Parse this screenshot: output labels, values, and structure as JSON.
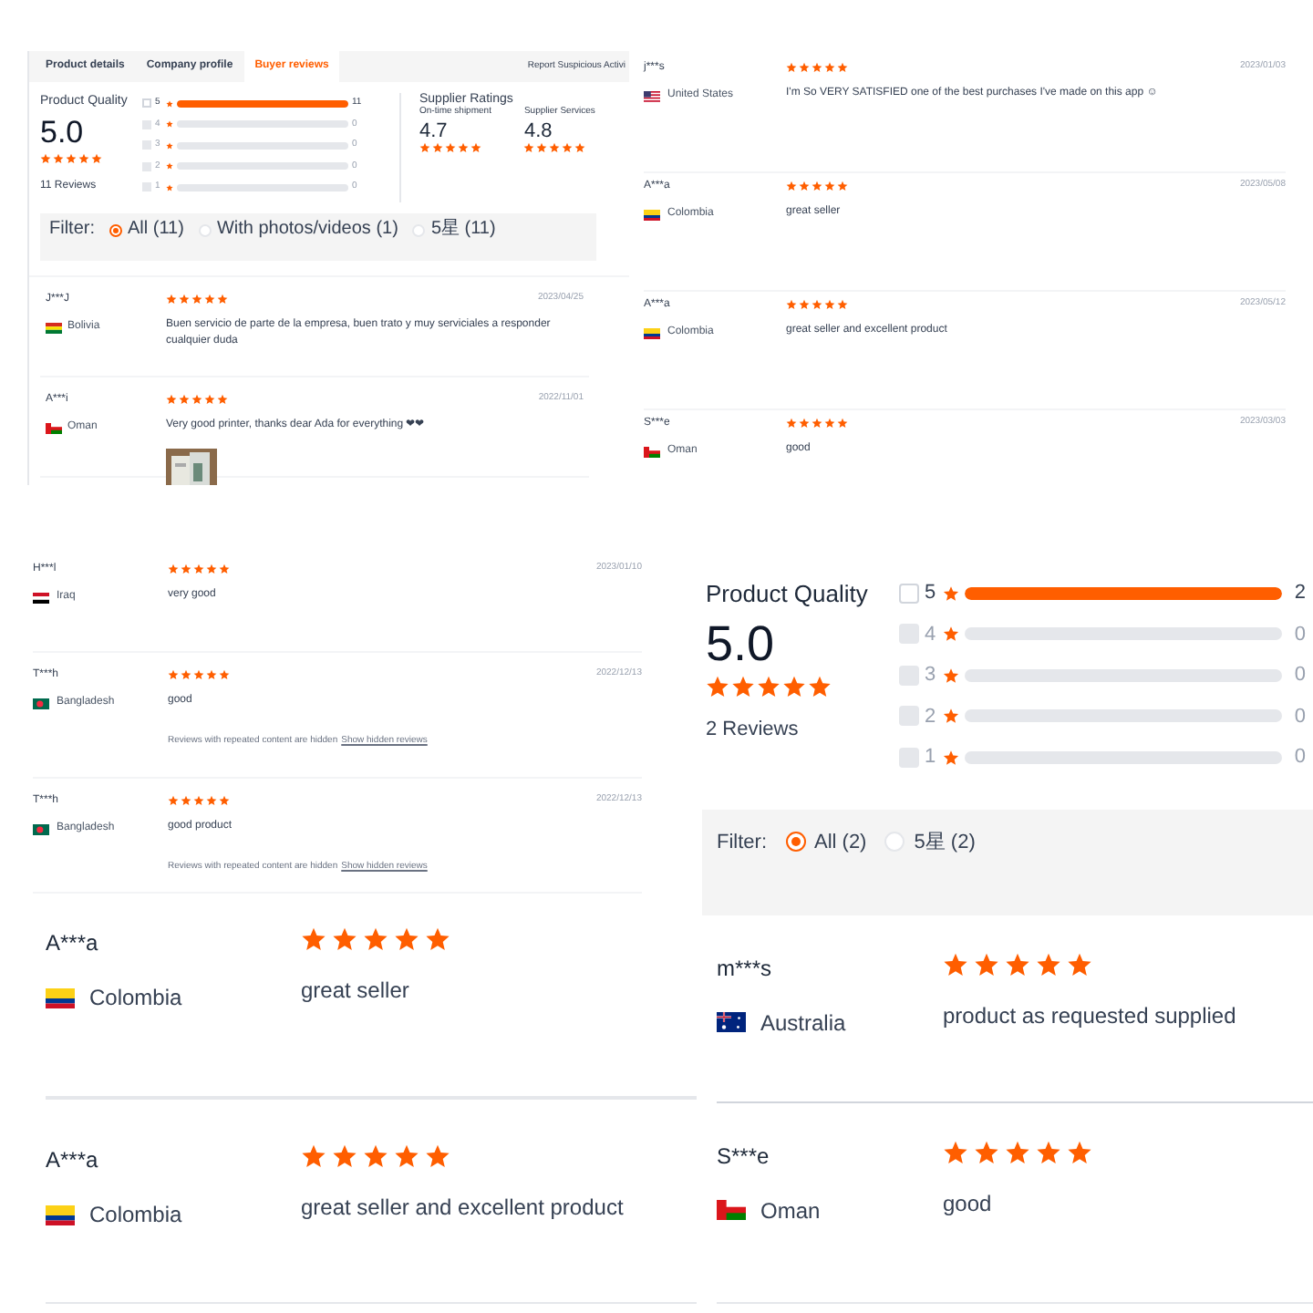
{
  "panel_1": {
    "tabs": [
      {
        "label": "Product details",
        "selected": false
      },
      {
        "label": "Company profile",
        "selected": false
      },
      {
        "label": "Buyer reviews",
        "selected": true
      }
    ],
    "report_link": "Report Suspicious Activi",
    "product_quality": {
      "title": "Product Quality",
      "score": "5.0",
      "stars": 5,
      "reviews_count": "11 Reviews",
      "bars": [
        {
          "label": "5",
          "count": "11",
          "level": 1,
          "disabled": false
        },
        {
          "label": "4",
          "count": "0",
          "level": 0,
          "disabled": true
        },
        {
          "label": "3",
          "count": "0",
          "level": 0,
          "disabled": true
        },
        {
          "label": "2",
          "count": "0",
          "level": 0,
          "disabled": true
        },
        {
          "label": "1",
          "count": "0",
          "level": 0,
          "disabled": true
        }
      ]
    },
    "supplier_ratings": {
      "title": "Supplier Ratings",
      "items": [
        {
          "label": "On-time shipment",
          "score": "4.7",
          "stars": 5
        },
        {
          "label": "Supplier Services",
          "score": "4.8",
          "stars": 5
        }
      ]
    },
    "filter": {
      "label": "Filter:",
      "options": [
        {
          "label": "All (11)",
          "selected": true
        },
        {
          "label": "With photos/videos (1)",
          "selected": false
        },
        {
          "label": "5星 (11)",
          "selected": false
        }
      ]
    },
    "reviews": [
      {
        "name": "J***J",
        "flag": {
          "kind": "bo"
        },
        "country": "Bolivia",
        "stars": 5,
        "date": "2023/04/25",
        "text": "Buen servicio de parte de la empresa, buen trato y muy serviciales a responder cualquier duda"
      },
      {
        "name": "A***i",
        "flag": {
          "kind": "om"
        },
        "country": "Oman",
        "stars": 5,
        "date": "2022/11/01",
        "text": "Very good printer, thanks dear Ada for everything ❤❤"
      }
    ]
  },
  "panel_2": {
    "reviews": [
      {
        "name": "j***s",
        "flag": {
          "kind": "us"
        },
        "country": "United States",
        "stars": 5,
        "date": "2023/01/03",
        "text": "I'm So VERY SATISFIED one of the best purchases I've made on this app ☺"
      },
      {
        "name": "A***a",
        "flag": {
          "kind": "co"
        },
        "country": "Colombia",
        "stars": 5,
        "date": "2023/05/08",
        "text": "great seller"
      },
      {
        "name": "A***a",
        "flag": {
          "kind": "co"
        },
        "country": "Colombia",
        "stars": 5,
        "date": "2023/05/12",
        "text": "great seller and excellent product"
      },
      {
        "name": "S***e",
        "flag": {
          "kind": "om"
        },
        "country": "Oman",
        "stars": 5,
        "date": "2023/03/03",
        "text": "good"
      }
    ]
  },
  "panel_3": {
    "reviews": [
      {
        "name": "H***l",
        "flag": {
          "kind": "iq"
        },
        "country": "Iraq",
        "stars": 5,
        "date": "2023/01/10",
        "text": "very good"
      },
      {
        "name": "T***h",
        "flag": {
          "kind": "bd"
        },
        "country": "Bangladesh",
        "stars": 5,
        "date": "2022/12/13",
        "text": "good",
        "note": "Reviews with repeated content are hidden",
        "link": "Show hidden reviews"
      },
      {
        "name": "T***h",
        "flag": {
          "kind": "bd"
        },
        "country": "Bangladesh",
        "stars": 5,
        "date": "2022/12/13",
        "text": "good product",
        "note": "Reviews with repeated content are hidden",
        "link": "Show hidden reviews"
      }
    ]
  },
  "panel_4": {
    "reviews": [
      {
        "name": "A***a",
        "flag": {
          "kind": "co"
        },
        "country": "Colombia",
        "stars": 5,
        "text": "great seller"
      },
      {
        "name": "A***a",
        "flag": {
          "kind": "co"
        },
        "country": "Colombia",
        "stars": 5,
        "text": "great seller and excellent product"
      }
    ]
  },
  "panel_5": {
    "product_quality": {
      "title": "Product Quality",
      "score": "5.0",
      "stars": 5,
      "reviews_count": "2 Reviews",
      "bars": [
        {
          "label": "5",
          "count": "2",
          "level": 1,
          "disabled": false
        },
        {
          "label": "4",
          "count": "0",
          "level": 0,
          "disabled": true
        },
        {
          "label": "3",
          "count": "0",
          "level": 0,
          "disabled": true
        },
        {
          "label": "2",
          "count": "0",
          "level": 0,
          "disabled": true
        },
        {
          "label": "1",
          "count": "0",
          "level": 0,
          "disabled": true
        }
      ]
    },
    "filter": {
      "label": "Filter:",
      "options": [
        {
          "label": "All (2)",
          "selected": true
        },
        {
          "label": "5星 (2)",
          "selected": false
        }
      ]
    },
    "reviews": [
      {
        "name": "m***s",
        "flag": {
          "kind": "au"
        },
        "country": "Australia",
        "stars": 5,
        "text": "product as requested supplied"
      },
      {
        "name": "S***e",
        "flag": {
          "kind": "om"
        },
        "country": "Oman",
        "stars": 5,
        "text": "good"
      }
    ]
  }
}
